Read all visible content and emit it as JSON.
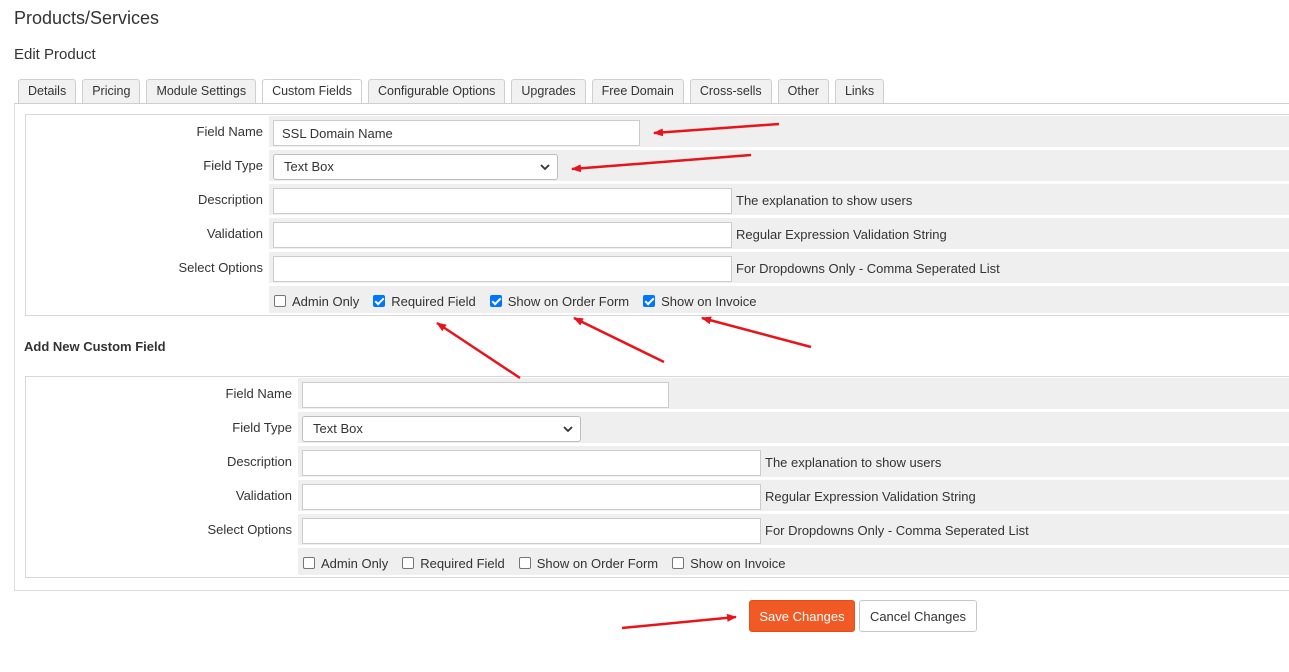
{
  "page": {
    "title": "Products/Services",
    "subtitle": "Edit Product"
  },
  "tabs": [
    {
      "label": "Details",
      "active": false
    },
    {
      "label": "Pricing",
      "active": false
    },
    {
      "label": "Module Settings",
      "active": false
    },
    {
      "label": "Custom Fields",
      "active": true
    },
    {
      "label": "Configurable Options",
      "active": false
    },
    {
      "label": "Upgrades",
      "active": false
    },
    {
      "label": "Free Domain",
      "active": false
    },
    {
      "label": "Cross-sells",
      "active": false
    },
    {
      "label": "Other",
      "active": false
    },
    {
      "label": "Links",
      "active": false
    }
  ],
  "existing_field": {
    "field_name_label": "Field Name",
    "field_name_value": "SSL Domain Name",
    "field_type_label": "Field Type",
    "field_type_value": "Text Box",
    "description_label": "Description",
    "description_value": "",
    "description_hint": "The explanation to show users",
    "validation_label": "Validation",
    "validation_value": "",
    "validation_hint": "Regular Expression Validation String",
    "select_options_label": "Select Options",
    "select_options_value": "",
    "select_options_hint": "For Dropdowns Only - Comma Seperated List",
    "checkboxes": [
      {
        "label": "Admin Only",
        "checked": false
      },
      {
        "label": "Required Field",
        "checked": true
      },
      {
        "label": "Show on Order Form",
        "checked": true
      },
      {
        "label": "Show on Invoice",
        "checked": true
      }
    ]
  },
  "new_field": {
    "section_title": "Add New Custom Field",
    "field_name_label": "Field Name",
    "field_name_value": "",
    "field_type_label": "Field Type",
    "field_type_value": "Text Box",
    "description_label": "Description",
    "description_value": "",
    "description_hint": "The explanation to show users",
    "validation_label": "Validation",
    "validation_value": "",
    "validation_hint": "Regular Expression Validation String",
    "select_options_label": "Select Options",
    "select_options_value": "",
    "select_options_hint": "For Dropdowns Only - Comma Seperated List",
    "checkboxes": [
      {
        "label": "Admin Only",
        "checked": false
      },
      {
        "label": "Required Field",
        "checked": false
      },
      {
        "label": "Show on Order Form",
        "checked": false
      },
      {
        "label": "Show on Invoice",
        "checked": false
      }
    ]
  },
  "buttons": {
    "save": "Save Changes",
    "cancel": "Cancel Changes"
  },
  "colors": {
    "accent": "#f15a24",
    "checkbox": "#0075ff",
    "annotation_arrow": "#e8141b"
  },
  "icons": {
    "select_caret": "chevron-down-icon",
    "annotation": "red-arrow-icon"
  }
}
